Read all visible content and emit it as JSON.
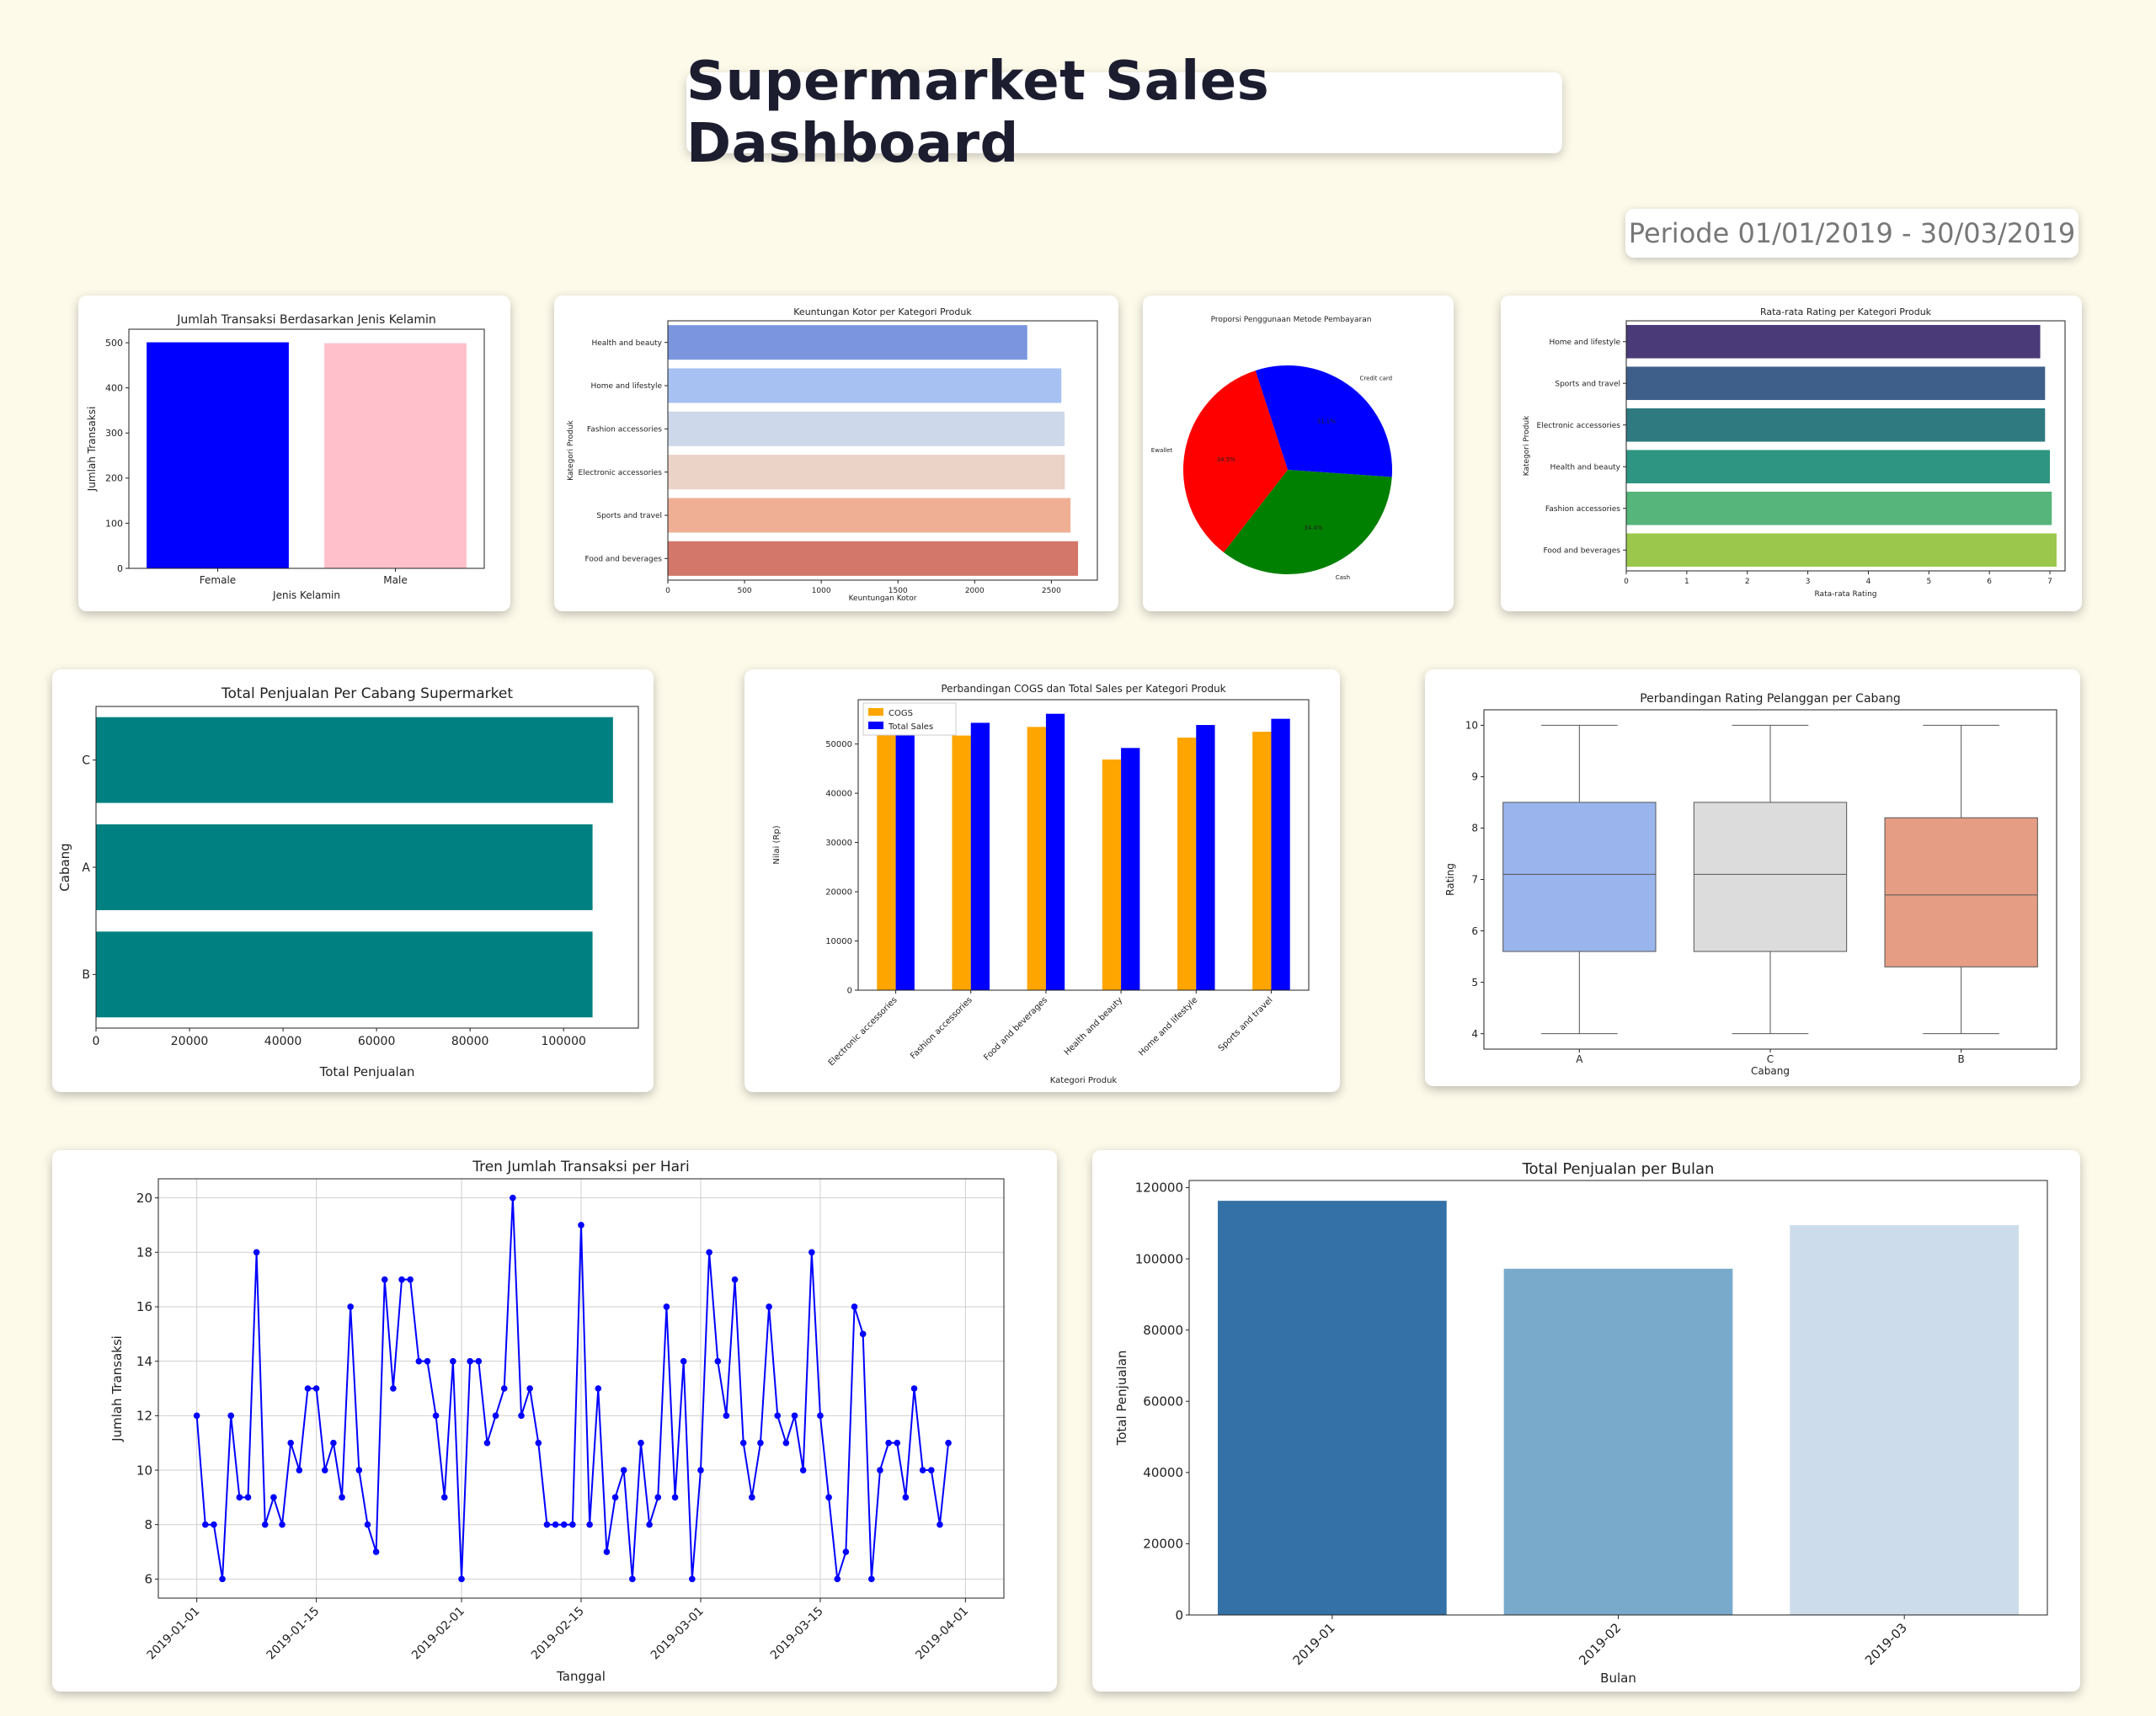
{
  "dashboard": {
    "title": "Supermarket Sales Dashboard",
    "period": "Periode 01/01/2019 - 30/03/2019"
  },
  "chart_data": [
    {
      "id": "gender",
      "type": "bar",
      "title": "Jumlah Transaksi Berdasarkan Jenis Kelamin",
      "xlabel": "Jenis Kelamin",
      "ylabel": "Jumlah Transaksi",
      "categories": [
        "Female",
        "Male"
      ],
      "values": [
        501,
        499
      ],
      "colors": [
        "#0000ff",
        "#ffc0cb"
      ],
      "ylim": [
        0,
        530
      ],
      "yticks": [
        0,
        100,
        200,
        300,
        400,
        500
      ],
      "grid": false
    },
    {
      "id": "gross_income",
      "type": "bar",
      "orientation": "horizontal",
      "title": "Keuntungan Kotor per Kategori Produk",
      "xlabel": "Keuntungan Kotor",
      "ylabel": "Kategori Produk",
      "categories": [
        "Health and beauty",
        "Home and lifestyle",
        "Fashion accessories",
        "Electronic accessories",
        "Sports and travel",
        "Food and beverages"
      ],
      "values": [
        2343,
        2565,
        2586,
        2588,
        2625,
        2674
      ],
      "colors": [
        "#7b96de",
        "#a6c1f2",
        "#cdd9ea",
        "#ebd3c8",
        "#eeaf95",
        "#d2776a"
      ],
      "xlim": [
        0,
        2800
      ],
      "xticks": [
        0,
        500,
        1000,
        1500,
        2000,
        2500
      ],
      "grid": false
    },
    {
      "id": "payment",
      "type": "pie",
      "title": "Proporsi Penggunaan Metode Pembayaran",
      "labels": [
        "Credit card",
        "Cash",
        "Ewallet"
      ],
      "values": [
        31.1,
        34.4,
        34.5
      ],
      "pct_labels": [
        "31.1%",
        "34.4%",
        "34.5%"
      ],
      "colors": [
        "#0000ff",
        "#008000",
        "#ff0000"
      ]
    },
    {
      "id": "rating_category",
      "type": "bar",
      "orientation": "horizontal",
      "title": "Rata-rata Rating per Kategori Produk",
      "xlabel": "Rata-rata Rating",
      "ylabel": "Kategori Produk",
      "categories": [
        "Home and lifestyle",
        "Sports and travel",
        "Electronic accessories",
        "Health and beauty",
        "Fashion accessories",
        "Food and beverages"
      ],
      "values": [
        6.84,
        6.92,
        6.92,
        7.0,
        7.03,
        7.11
      ],
      "colors": [
        "#4a3a78",
        "#3e5f8a",
        "#2e7a80",
        "#2e9583",
        "#55b57a",
        "#9bc84c"
      ],
      "xlim": [
        0,
        7.25
      ],
      "xticks": [
        0,
        1,
        2,
        3,
        4,
        5,
        6,
        7
      ],
      "grid": false
    },
    {
      "id": "branch_sales",
      "type": "bar",
      "orientation": "horizontal",
      "title": "Total Penjualan Per Cabang Supermarket",
      "xlabel": "Total Penjualan",
      "ylabel": "Cabang",
      "categories": [
        "C",
        "A",
        "B"
      ],
      "values": [
        110569,
        106200,
        106198
      ],
      "colors": [
        "#008080",
        "#008080",
        "#008080"
      ],
      "xlim": [
        0,
        116000
      ],
      "xticks": [
        0,
        20000,
        40000,
        60000,
        80000,
        100000
      ],
      "grid": false
    },
    {
      "id": "cogs_sales",
      "type": "bar",
      "title": "Perbandingan COGS dan Total Sales per Kategori Produk",
      "xlabel": "Kategori Produk",
      "ylabel": "Nilai (Rp)",
      "categories": [
        "Electronic accessories",
        "Fashion accessories",
        "Food and beverages",
        "Health and beauty",
        "Home and lifestyle",
        "Sports and travel"
      ],
      "series": [
        {
          "name": "COGS",
          "values": [
            51750,
            51719,
            53471,
            46851,
            51298,
            52497
          ],
          "color": "#ffa500"
        },
        {
          "name": "Total Sales",
          "values": [
            54337,
            54306,
            56145,
            49194,
            53862,
            55123
          ],
          "color": "#0000ff"
        }
      ],
      "legend": "top-left",
      "ylim": [
        0,
        59000
      ],
      "yticks": [
        0,
        10000,
        20000,
        30000,
        40000,
        50000
      ],
      "grid": false
    },
    {
      "id": "rating_branch",
      "type": "boxplot",
      "title": "Perbandingan Rating Pelanggan per Cabang",
      "xlabel": "Cabang",
      "ylabel": "Rating",
      "categories": [
        "A",
        "C",
        "B"
      ],
      "boxes": [
        {
          "min": 4.0,
          "q1": 5.6,
          "median": 7.1,
          "q3": 8.5,
          "max": 10.0
        },
        {
          "min": 4.0,
          "q1": 5.6,
          "median": 7.1,
          "q3": 8.5,
          "max": 10.0
        },
        {
          "min": 4.0,
          "q1": 5.3,
          "median": 6.7,
          "q3": 8.2,
          "max": 10.0
        }
      ],
      "colors": [
        "#9ab5ee",
        "#dcdcdc",
        "#e59d84"
      ],
      "ylim": [
        3.7,
        10.3
      ],
      "yticks": [
        4,
        5,
        6,
        7,
        8,
        9,
        10
      ],
      "grid": false
    },
    {
      "id": "daily_trend",
      "type": "line",
      "title": "Tren Jumlah Transaksi per Hari",
      "xlabel": "Tanggal",
      "ylabel": "Jumlah Transaksi",
      "start_date": "2019-01-01",
      "values": [
        12,
        8,
        8,
        6,
        12,
        9,
        9,
        18,
        8,
        9,
        8,
        11,
        10,
        13,
        13,
        10,
        11,
        9,
        16,
        10,
        8,
        7,
        17,
        13,
        17,
        17,
        14,
        14,
        12,
        9,
        14,
        6,
        14,
        14,
        11,
        12,
        13,
        20,
        12,
        13,
        11,
        8,
        8,
        8,
        8,
        19,
        8,
        13,
        7,
        9,
        10,
        6,
        11,
        8,
        9,
        16,
        9,
        14,
        6,
        10,
        18,
        14,
        12,
        17,
        11,
        9,
        11,
        16,
        12,
        11,
        12,
        10,
        18,
        12,
        9,
        6,
        7,
        16,
        15,
        6,
        10,
        11,
        11,
        9,
        13,
        10,
        10,
        8,
        11
      ],
      "xticks": [
        "2019-01-01",
        "2019-01-15",
        "2019-02-01",
        "2019-02-15",
        "2019-03-01",
        "2019-03-15",
        "2019-04-01"
      ],
      "yticks": [
        6,
        8,
        10,
        12,
        14,
        16,
        18,
        20
      ],
      "ylim": [
        5.3,
        20.7
      ],
      "color": "#0000ff",
      "grid": true
    },
    {
      "id": "monthly_sales",
      "type": "bar",
      "title": "Total Penjualan per Bulan",
      "xlabel": "Bulan",
      "ylabel": "Total Penjualan",
      "categories": [
        "2019-01",
        "2019-02",
        "2019-03"
      ],
      "values": [
        116292,
        97219,
        109456
      ],
      "colors": [
        "#3371a6",
        "#79aacb",
        "#ccdcea"
      ],
      "ylim": [
        0,
        122000
      ],
      "yticks": [
        0,
        20000,
        40000,
        60000,
        80000,
        100000,
        120000
      ],
      "grid": false
    }
  ]
}
